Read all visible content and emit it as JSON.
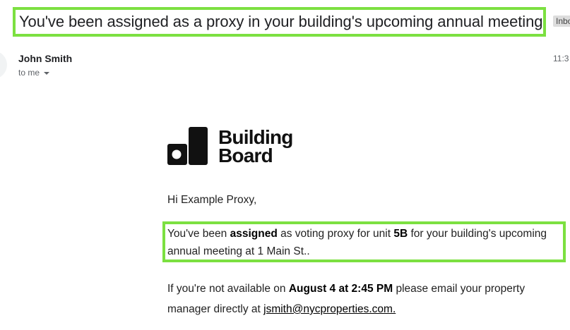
{
  "email": {
    "subject": "You've been assigned as a proxy in your building's upcoming annual meeting",
    "label_badge": "Inbo",
    "sender": "John Smith",
    "recipient": "to me",
    "time": "11:3"
  },
  "logo": {
    "line1": "Building",
    "line2": "Board"
  },
  "message": {
    "greeting": "Hi Example Proxy,",
    "assign_1": "You've been ",
    "assign_bold_1": "assigned",
    "assign_2": " as voting proxy for unit ",
    "assign_bold_unit": "5B",
    "assign_3": " for your building's upcoming annual meeting at 1 Main St..",
    "avail_1": "If you're not available on ",
    "avail_bold_date": "August 4 at 2:45 PM",
    "avail_2": " please email your property manager directly at ",
    "manager_email": "jsmith@nycproperties.com."
  },
  "colors": {
    "highlight": "#7ce041"
  }
}
